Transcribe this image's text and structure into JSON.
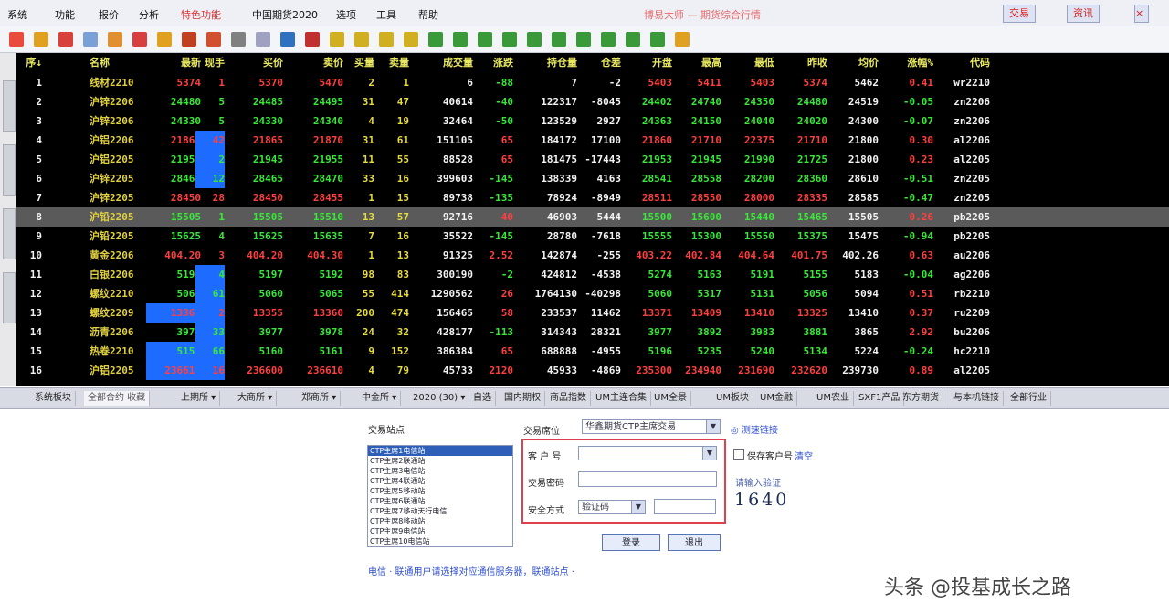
{
  "menu": {
    "items": [
      "系统",
      "功能",
      "报价",
      "分析",
      "特色功能",
      "中国期货2020",
      "选项",
      "工具",
      "帮助"
    ],
    "highlighted_index": 4
  },
  "window": {
    "title": "博易大师 — 期货综合行情",
    "button_trade": "交易",
    "button_news": "资讯"
  },
  "quote_table": {
    "headers": [
      "序↓",
      "名称",
      "最新",
      "现手",
      "买价",
      "卖价",
      "买量",
      "卖量",
      "成交量",
      "涨跌",
      "持仓量",
      "仓差",
      "开盘",
      "最高",
      "最低",
      "昨收",
      "均价",
      "涨幅%",
      "代码"
    ],
    "selected_row": 7,
    "rows": [
      [
        "1",
        "线材2210",
        "5374",
        "1",
        "5370",
        "5470",
        "2",
        "1",
        "6",
        "-88",
        "7",
        "-2",
        "5403",
        "5411",
        "5403",
        "5374",
        "5462",
        "0.41",
        "wr2210"
      ],
      [
        "2",
        "沪锌2206",
        "24480",
        "5",
        "24485",
        "24495",
        "31",
        "47",
        "40614",
        "-40",
        "122317",
        "-8045",
        "24402",
        "24740",
        "24350",
        "24480",
        "24519",
        "-0.05",
        "zn2206"
      ],
      [
        "3",
        "沪锌2206",
        "24330",
        "5",
        "24330",
        "24340",
        "4",
        "19",
        "32464",
        "-50",
        "123529",
        "2927",
        "24363",
        "24150",
        "24040",
        "24020",
        "24300",
        "-0.07",
        "zn2206"
      ],
      [
        "4",
        "沪铝2206",
        "21865",
        "42",
        "21865",
        "21870",
        "31",
        "61",
        "151105",
        "65",
        "184172",
        "17100",
        "21860",
        "21710",
        "22375",
        "21710",
        "21800",
        "0.30",
        "al2206"
      ],
      [
        "5",
        "沪铝2205",
        "21950",
        "2",
        "21945",
        "21955",
        "11",
        "55",
        "88528",
        "65",
        "181475",
        "-17443",
        "21953",
        "21945",
        "21990",
        "21725",
        "21800",
        "0.23",
        "al2205"
      ],
      [
        "6",
        "沪锌2205",
        "28465",
        "12",
        "28465",
        "28470",
        "33",
        "16",
        "399603",
        "-145",
        "138339",
        "4163",
        "28541",
        "28558",
        "28200",
        "28360",
        "28610",
        "-0.51",
        "zn2205"
      ],
      [
        "7",
        "沪锌2205",
        "28450",
        "28",
        "28450",
        "28455",
        "1",
        "15",
        "89738",
        "-135",
        "78924",
        "-8949",
        "28511",
        "28550",
        "28000",
        "28335",
        "28585",
        "-0.47",
        "zn2205"
      ],
      [
        "8",
        "沪铅2205",
        "15505",
        "1",
        "15505",
        "15510",
        "13",
        "57",
        "92716",
        "40",
        "46903",
        "5444",
        "15500",
        "15600",
        "15440",
        "15465",
        "15505",
        "0.26",
        "pb2205"
      ],
      [
        "9",
        "沪铅2205",
        "15625",
        "4",
        "15625",
        "15635",
        "7",
        "16",
        "35522",
        "-145",
        "28780",
        "-7618",
        "15555",
        "15300",
        "15550",
        "15375",
        "15475",
        "-0.94",
        "pb2205"
      ],
      [
        "10",
        "黄金2206",
        "404.20",
        "3",
        "404.20",
        "404.30",
        "1",
        "13",
        "91325",
        "2.52",
        "142874",
        "-255",
        "403.22",
        "402.84",
        "404.64",
        "401.75",
        "402.26",
        "0.63",
        "au2206"
      ],
      [
        "11",
        "白银2206",
        "5197",
        "4",
        "5197",
        "5192",
        "98",
        "83",
        "300190",
        "-2",
        "424812",
        "-4538",
        "5274",
        "5163",
        "5191",
        "5155",
        "5183",
        "-0.04",
        "ag2206"
      ],
      [
        "12",
        "螺纹2210",
        "5064",
        "61",
        "5060",
        "5065",
        "55",
        "414",
        "1290562",
        "26",
        "1764130",
        "-40298",
        "5060",
        "5317",
        "5131",
        "5056",
        "5094",
        "0.51",
        "rb2210"
      ],
      [
        "13",
        "螺纹2209",
        "13368",
        "2",
        "13355",
        "13360",
        "200",
        "474",
        "156465",
        "58",
        "233537",
        "11462",
        "13371",
        "13409",
        "13410",
        "13325",
        "13410",
        "0.37",
        "ru2209"
      ],
      [
        "14",
        "沥青2206",
        "3978",
        "33",
        "3977",
        "3978",
        "24",
        "32",
        "428177",
        "-113",
        "314343",
        "28321",
        "3977",
        "3892",
        "3983",
        "3881",
        "3865",
        "2.92",
        "bu2206"
      ],
      [
        "15",
        "热卷2210",
        "5159",
        "66",
        "5160",
        "5161",
        "9",
        "152",
        "386384",
        "65",
        "688888",
        "-4955",
        "5196",
        "5235",
        "5240",
        "5134",
        "5224",
        "-0.24",
        "hc2210"
      ],
      [
        "16",
        "沪铝2205",
        "236610",
        "16",
        "236600",
        "236610",
        "4",
        "79",
        "45733",
        "2120",
        "45933",
        "-4869",
        "235300",
        "234940",
        "231690",
        "232620",
        "239730",
        "0.89",
        "al2205"
      ]
    ]
  },
  "tabs": [
    "系统板块",
    "全部合约  收藏",
    "上期所 ▾",
    "大商所 ▾",
    "郑商所 ▾",
    "中金所 ▾",
    "2020 (30) ▾",
    "自选",
    "国内期权",
    "商品指数",
    "UM主连合集",
    "UM全景",
    "UM板块",
    "UM金融",
    "UM农业",
    "SXF1产品",
    "东方期货",
    "与本机链接",
    "全部行业"
  ],
  "active_tab": 1,
  "login": {
    "site_label": "交易站点",
    "sites": [
      "CTP主席1电信站",
      "CTP主席2联通站",
      "CTP主席3电信站",
      "CTP主席4联通站",
      "CTP主席5移动站",
      "CTP主席6联通站",
      "CTP主席7移动天行电信",
      "CTP主席8移动站",
      "CTP主席9电信站",
      "CTP主席10电信站"
    ],
    "selected_site_index": 0,
    "company_label": "交易席位",
    "company_value": "华鑫期货CTP主席交易",
    "account_label": "客 户 号",
    "password_label": "交易密码",
    "verify_label": "安全方式",
    "verify_value": "验证码",
    "test_speed_link": "◎ 测速链接",
    "save_account_label": "保存客户号",
    "save_account_link": "清空",
    "captcha_hint": "请输入验证",
    "captcha_text": "1640",
    "login_button": "登录",
    "exit_button": "退出",
    "footer_link": "电信 · 联通用户请选择对应通信服务器，联通站点 ·"
  },
  "watermark": "头条 @投基成长之路",
  "colors": {
    "up": "#ff4040",
    "down": "#38e838",
    "name": "#e0d040",
    "highlight_box": "#e0404b",
    "bid_ask_bg": "#1e6cff"
  }
}
